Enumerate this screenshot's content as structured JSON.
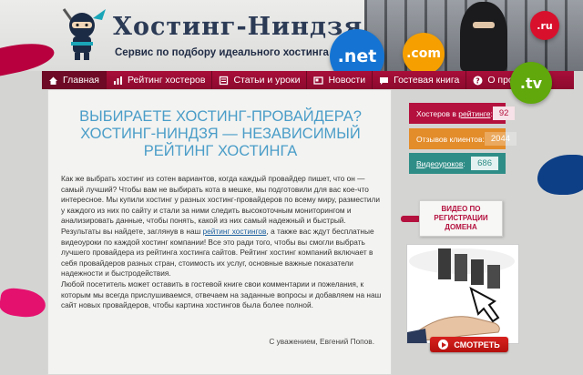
{
  "site": {
    "logo_title": "Хостинг-Ниндзя",
    "logo_subtitle": "Сервис по подбору идеального хостинга"
  },
  "domains": {
    "net": ".net",
    "com": ".com",
    "ru": ".ru",
    "tv": ".tv"
  },
  "nav": {
    "items": [
      {
        "label": "Главная",
        "icon": "home-icon",
        "active": true
      },
      {
        "label": "Рейтинг хостеров",
        "icon": "chart-icon",
        "active": false
      },
      {
        "label": "Статьи и уроки",
        "icon": "book-icon",
        "active": false
      },
      {
        "label": "Новости",
        "icon": "news-icon",
        "active": false
      },
      {
        "label": "Гостевая книга",
        "icon": "guestbook-icon",
        "active": false
      },
      {
        "label": "О проекте",
        "icon": "question-icon",
        "active": false
      }
    ]
  },
  "main": {
    "headline": "ВЫБИРАЕТЕ ХОСТИНГ-ПРОВАЙДЕРА? ХОСТИНГ-НИНДЗЯ — НЕЗАВИСИМЫЙ РЕЙТИНГ ХОСТИНГА",
    "para_1": "Как же выбрать хостинг из сотен вариантов, когда каждый провайдер пишет, что он — самый лучший? Чтобы вам не выбирать кота в мешке, мы подготовили для вас кое-что интересное. Мы купили хостинг у разных хостинг-провайдеров по всему миру, разместили у каждого из них по сайту и стали за ними следить высокоточным мониторингом и анализировать данные, чтобы понять, какой из них самый надежный и быстрый. Результаты вы найдете, заглянув в наш ",
    "para_1_link": "рейтинг хостингов",
    "para_1_end": ", а также вас ждут бесплатные видеоуроки по каждой хостинг компании! Все это ради того, чтобы вы смогли выбрать лучшего провайдера из рейтинга хостинга сайтов. Рейтинг хостинг компаний включает в себя провайдеров разных стран, стоимость их услуг, основные важные показатели надежности и быстродействия.",
    "para_2": "Любой посетитель может оставить в гостевой книге свои комментарии и пожелания, к которым мы всегда прислушиваемся, отвечаем на заданные вопросы и добавляем на наш сайт новых провайдеров, чтобы картина хостингов была более полной.",
    "signature": "С уважением, Евгений Попов."
  },
  "stats": {
    "hosters_label_pre": "Хостеров в ",
    "hosters_label_link": "рейтинге",
    "hosters_label_post": ":",
    "hosters_value": "92",
    "reviews_label": "Отзывов клиентов:",
    "reviews_value": "2044",
    "videos_label_link": "Видеоуроков",
    "videos_label_post": ":",
    "videos_value": "686"
  },
  "video": {
    "tag_line_1": "ВИДЕО ПО",
    "tag_line_2": "РЕГИСТРАЦИИ",
    "tag_line_3": "ДОМЕНА",
    "play_label": "СМОТРЕТЬ"
  },
  "colors": {
    "accent": "#a80e39",
    "headline": "#4a9dc8",
    "stat_orange": "#e38c2a",
    "stat_teal": "#2f8d87"
  }
}
